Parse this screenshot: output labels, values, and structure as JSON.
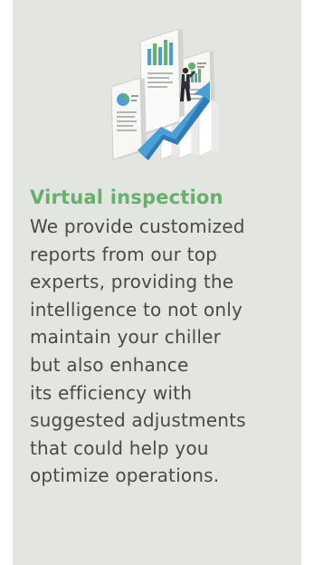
{
  "feature": {
    "icon": "analytics-reports-illustration",
    "title": "Virtual inspection",
    "description_lines": [
      "We provide customized",
      "reports from our top",
      "experts, providing the",
      "intelligence to not only",
      "maintain your chiller",
      "but also enhance",
      "its efficiency with",
      "suggested adjustments",
      "that could help you",
      "optimize operations."
    ]
  },
  "colors": {
    "card_background": "#e3e5e1",
    "title": "#66b06c",
    "body_text": "#4a4a4a",
    "arrow_blue": "#4a9fd6"
  }
}
